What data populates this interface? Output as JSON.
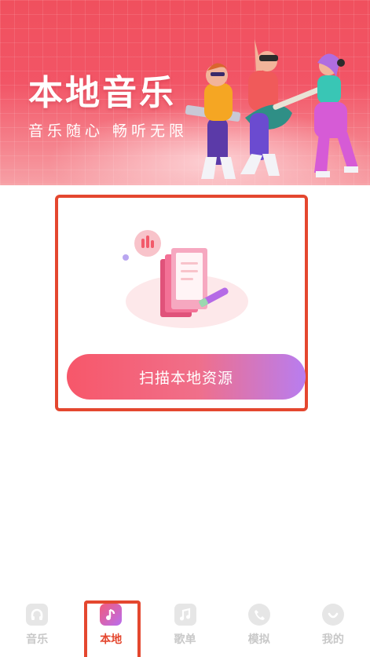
{
  "banner": {
    "title": "本地音乐",
    "subtitle": "音乐随心 畅听无限"
  },
  "scan_card": {
    "button_label": "扫描本地资源"
  },
  "bottom_nav": {
    "items": [
      {
        "label": "音乐",
        "icon": "music-disc-icon",
        "active": false
      },
      {
        "label": "本地",
        "icon": "music-note-icon",
        "active": true
      },
      {
        "label": "歌单",
        "icon": "playlist-note-icon",
        "active": false
      },
      {
        "label": "模拟",
        "icon": "phone-icon",
        "active": false
      },
      {
        "label": "我的",
        "icon": "profile-icon",
        "active": false
      }
    ]
  },
  "colors": {
    "brand_red": "#f0505e",
    "highlight_outline": "#e4472f",
    "button_gradient_start": "#f7576a",
    "button_gradient_end": "#b87df0",
    "inactive_tab": "#c8c8c8"
  }
}
